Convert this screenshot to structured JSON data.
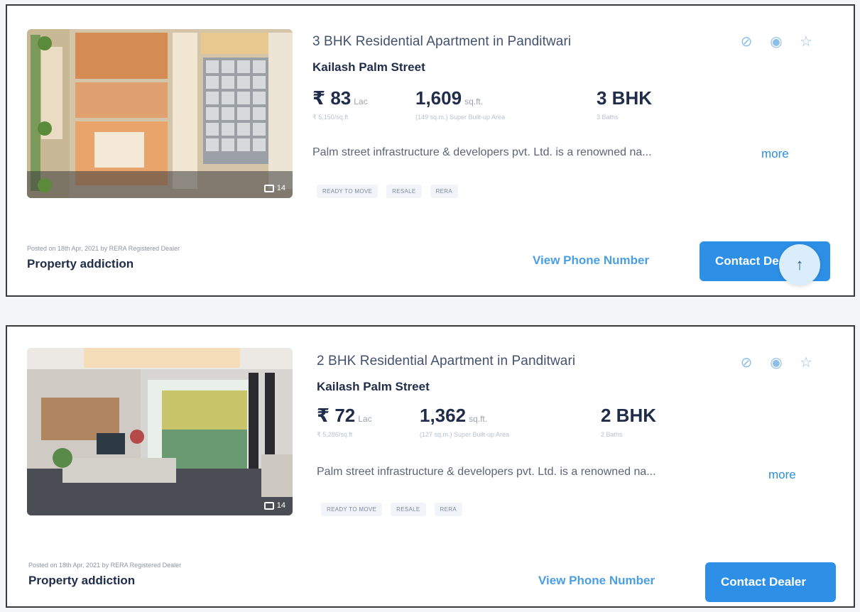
{
  "listings": [
    {
      "title": "3 BHK Residential Apartment in Panditwari",
      "project": "Kailash Palm Street",
      "price": "₹ 83",
      "price_unit": "Lac",
      "price_sub": "₹ 5,150/sq.ft",
      "area": "1,609",
      "area_unit": "sq.ft.",
      "area_sub": "(149 sq.m.) Super Built-up Area",
      "bhk": "3 BHK",
      "bhk_sub": "3 Baths",
      "description": "Palm street infrastructure & developers pvt. Ltd. is a renowned na...",
      "more": "more",
      "tags": [
        "READY TO MOVE",
        "RESALE",
        "RERA"
      ],
      "photo_count": "14",
      "posted": "Posted on 18th Apr, 2021 by RERA Registered Dealer",
      "dealer": "Property addiction",
      "phone_label": "View Phone Number",
      "contact_label": "Contact Dealer"
    },
    {
      "title": "2 BHK Residential Apartment in Panditwari",
      "project": "Kailash Palm Street",
      "price": "₹ 72",
      "price_unit": "Lac",
      "price_sub": "₹ 5,286/sq.ft",
      "area": "1,362",
      "area_unit": "sq.ft.",
      "area_sub": "(127 sq.m.) Super Built-up Area",
      "bhk": "2 BHK",
      "bhk_sub": "2 Baths",
      "description": "Palm street infrastructure & developers pvt. Ltd. is a renowned na...",
      "more": "more",
      "tags": [
        "READY TO MOVE",
        "RESALE",
        "RERA"
      ],
      "photo_count": "14",
      "posted": "Posted on 18th Apr, 2021 by RERA Registered Dealer",
      "dealer": "Property addiction",
      "phone_label": "View Phone Number",
      "contact_label": "Contact Dealer"
    }
  ],
  "icons": {
    "hide": "ban-icon",
    "view": "eye-slash-icon",
    "shortlist": "star-icon",
    "scroll_top": "arrow-up-icon"
  },
  "scroll_top_label": "↑",
  "colors": {
    "accent": "#2d8fe6",
    "link": "#2b8fe0",
    "title": "#1f2d4a"
  }
}
